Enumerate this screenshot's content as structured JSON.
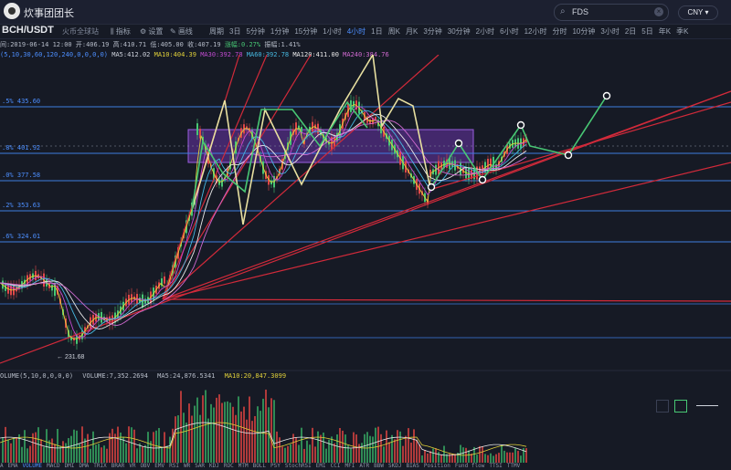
{
  "app": {
    "brand": "炊事团团长",
    "search_value": "FDS",
    "currency": "CNY"
  },
  "toolbar": {
    "pair": "BCH/USDT",
    "exchange": "火币全球站",
    "indicators_label": "指标",
    "settings_label": "设置",
    "draw_label": "画线",
    "period_label": "周期",
    "intervals": [
      "3日",
      "5分钟",
      "1分钟",
      "15分钟",
      "1小时",
      "4小时",
      "1日",
      "周K",
      "月K",
      "3分钟",
      "30分钟",
      "2小时",
      "6小时",
      "12小时",
      "分时",
      "10分钟",
      "3小时",
      "2日",
      "5日",
      "年K",
      "季K"
    ],
    "active_interval": "4小时"
  },
  "ohlc": {
    "time_label": "间:2019-06-14 12:00",
    "open": "开:406.19",
    "high": "高:410.71",
    "low": "低:405.00",
    "close": "收:407.19",
    "change": "涨幅:0.27%",
    "amplitude": "振幅:1.41%"
  },
  "ma_info": {
    "params": "(5,10,30,60,120,240,0,0,0,0)",
    "ma5": "MA5:412.02",
    "ma10": "MA10:404.39",
    "ma30": "MA30:392.78",
    "ma60": "MA60:392.78",
    "ma120": "MA120:411.00",
    "ma240": "MA240:384.76"
  },
  "fib_levels": [
    {
      "label": ".5% 435.60"
    },
    {
      "label": ".8% 401.92"
    },
    {
      "label": ".0% 377.58"
    },
    {
      "label": ".2% 353.63"
    },
    {
      "label": ".6% 324.01"
    }
  ],
  "min_price_label": "← 231.68",
  "volume_info": {
    "title": "OLUME(5,10,0,0,0,0)",
    "volume": "VOLUME:7,352.2694",
    "ma5": "MA5:24,876.5341",
    "ma10": "MA10:20,847.3099"
  },
  "bottom_tabs": [
    "A",
    "EMA",
    "VOLUME",
    "MACD",
    "DMI",
    "DMA",
    "TRIX",
    "BRAR",
    "VR",
    "OBV",
    "EMV",
    "RSI",
    "WR",
    "SAR",
    "KDJ",
    "ROC",
    "MTM",
    "BOLL",
    "PSY",
    "StochRSI",
    "EMI",
    "CCI",
    "MFI",
    "ATR",
    "BBW",
    "SKDJ",
    "BIAS",
    "Position",
    "Fund flow",
    "TTSI",
    "TTMV"
  ],
  "active_bottom_tab": "VOLUME",
  "colors": {
    "bg": "#161a25",
    "accent": "#4d8fff",
    "up": "#48c774",
    "down": "#e04848",
    "fib_line": "#3d7de0",
    "zone": "#7a3fbf"
  }
}
